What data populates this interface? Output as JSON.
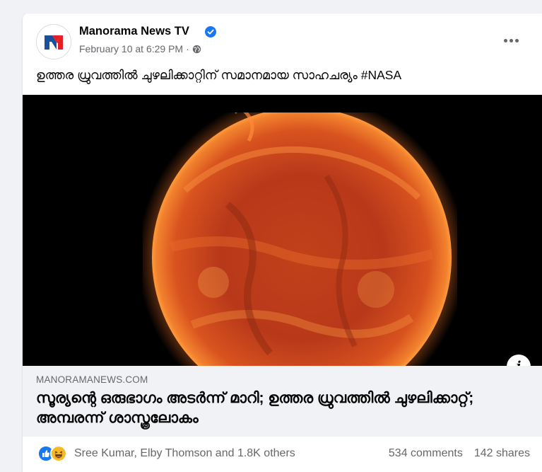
{
  "post": {
    "author": "Manorama News TV",
    "timestamp": "February 10 at 6:29 PM",
    "separator": "·",
    "caption": "ഉത്തര ധ്രുവത്തിൽ ചുഴലിക്കാറ്റിന് സമാനമായ സാഹചര്യം #NASA",
    "image_icon": "info-icon",
    "info_glyph": "i"
  },
  "link_preview": {
    "domain": "MANORAMANEWS.COM",
    "title": "സൂര്യന്റെ ഒരുഭാഗം അടർന്ന് മാറി; ഉത്തര ധ്രുവത്തിൽ ചുഴലിക്കാറ്റ്; അമ്പരന്ന് ശാസ്ത്രലോകം"
  },
  "engagement": {
    "reactions": [
      "like-icon",
      "haha-icon"
    ],
    "reactors_text": "Sree Kumar, Elby Thomson and 1.8K others",
    "comments": "534 comments",
    "shares": "142 shares"
  },
  "colors": {
    "like_blue": "#1877f2",
    "haha_yellow": "#f7b928",
    "verified_blue": "#1877f2",
    "brand_red": "#e31e24",
    "brand_blue": "#1b4e9b"
  }
}
